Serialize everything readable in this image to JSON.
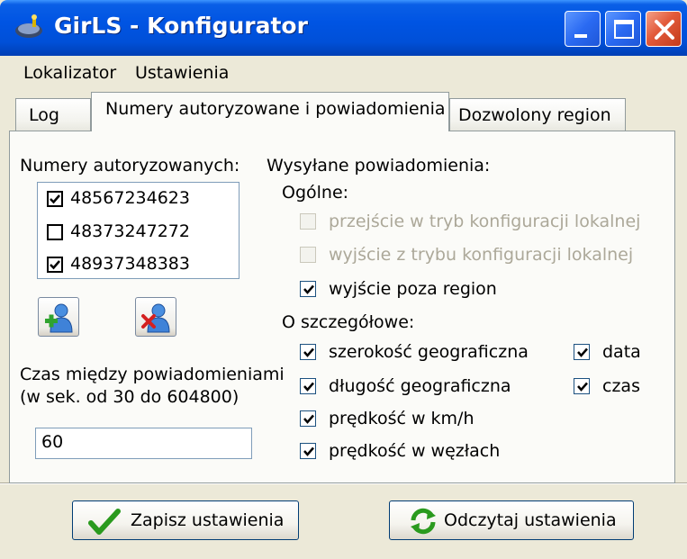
{
  "window": {
    "title": "GirLS - Konfigurator"
  },
  "menu": {
    "items": [
      "Lokalizator",
      "Ustawienia"
    ]
  },
  "tabs": [
    {
      "label": "Log",
      "active": false
    },
    {
      "label": "Numery autoryzowane i powiadomienia",
      "active": true
    },
    {
      "label": "Dozwolony region",
      "active": false
    }
  ],
  "authorized": {
    "heading": "Numery autoryzowanych:",
    "numbers": [
      {
        "number": "48567234623",
        "checked": true
      },
      {
        "number": "48373247272",
        "checked": false
      },
      {
        "number": "48937348383",
        "checked": true
      }
    ],
    "add_icon": "add-user-icon",
    "remove_icon": "remove-user-icon"
  },
  "interval": {
    "label_line1": "Czas między powiadomieniami",
    "label_line2": "(w sek. od 30 do 604800)",
    "value": "60"
  },
  "notifications": {
    "heading": "Wysyłane powiadomienia:",
    "general_heading": "Ogólne:",
    "general": [
      {
        "label": "przejście w tryb konfiguracji lokalnej",
        "checked": false,
        "enabled": false
      },
      {
        "label": "wyjście z trybu konfiguracji lokalnej",
        "checked": false,
        "enabled": false
      },
      {
        "label": "wyjście poza region",
        "checked": true,
        "enabled": true
      }
    ],
    "detail_heading": "O szczegółowe:",
    "detail_left": [
      {
        "label": "szerokość geograficzna",
        "checked": true
      },
      {
        "label": "długość geograficzna",
        "checked": true
      },
      {
        "label": "prędkość w km/h",
        "checked": true
      },
      {
        "label": "prędkość w węzłach",
        "checked": true
      }
    ],
    "detail_right": [
      {
        "label": "data",
        "checked": true
      },
      {
        "label": "czas",
        "checked": true
      }
    ]
  },
  "buttons": {
    "save_label": "Zapisz ustawienia",
    "read_label": "Odczytaj ustawienia"
  },
  "colors": {
    "titlebar": "#0054e3",
    "face": "#ece9d8",
    "panel": "#fbfbf8"
  }
}
